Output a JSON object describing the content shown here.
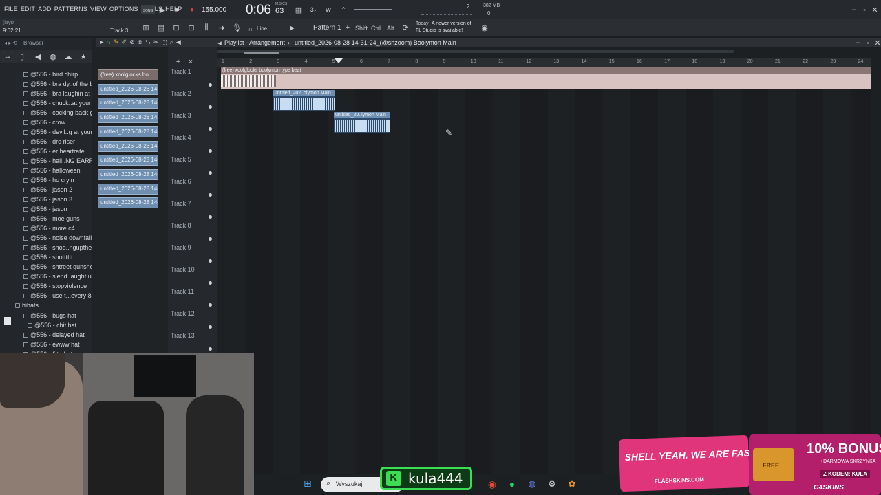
{
  "menu": [
    "FILE",
    "EDIT",
    "ADD",
    "PATTERNS",
    "VIEW",
    "OPTIONS",
    "TOOLS",
    "HELP"
  ],
  "transport": {
    "mode": "SONG",
    "bpm": "155.000",
    "time_main": "0:06",
    "time_sub": "63",
    "time_unit": "M:S:CS",
    "pattern": "Pattern 1",
    "line_mode": "Line",
    "num_a": "2",
    "num_b": "0"
  },
  "memory": "382 MB",
  "user": {
    "name": "(kryst",
    "time": "9:02:21"
  },
  "hint_label": "Track 3",
  "modifiers": [
    "Shift",
    "Ctrl",
    "Alt"
  ],
  "news": {
    "today": "Today",
    "line1": "A newer version of",
    "line2": "FL Studio is available!"
  },
  "browser": {
    "title": "Browser",
    "items": [
      "@556 - bird chirp",
      "@556 - bra dy..of the beat",
      "@556 - bra laughin at u",
      "@556 - chuck..at your cut",
      "@556 - cocking back gun",
      "@556 - crow",
      "@556 - devil..g at your cut",
      "@556 - dro riser",
      "@556 - er heartrate",
      "@556 - hall..NG EARRAPE)",
      "@556 - halloween",
      "@556 - ho cryin",
      "@556 - jason 2",
      "@556 - jason 3",
      "@556 - jason",
      "@556 - moe guns",
      "@556 - more c4",
      "@556 - noise downfall",
      "@556 - shoo..nguptheclub",
      "@556 - shotttttt",
      "@556 - shtreet gunshot",
      "@556 - slend..aught u bro",
      "@556 - stopviolence",
      "@556 - use t...every 8 bars"
    ],
    "folder": "hihats",
    "sub_items": [
      "@556 - bugs hat",
      "@556 - chit hat",
      "@556 - delayed hat",
      "@556 - ewww hat",
      "@556 - filta hat"
    ]
  },
  "clip_picker": [
    "(free) xoolglocks bo...",
    "untitled_2026-08-28 14-...",
    "untitled_2026-08-28 14-...",
    "untitled_2026-08-28 14-...",
    "untitled_2026-08-28 14-...",
    "untitled_2026-08-28 14-...",
    "untitled_2026-08-28 14-...",
    "untitled_2026-08-28 14-...",
    "untitled_2026-08-28 14-...",
    "untitled_2026-08-28 14-..."
  ],
  "playlist": {
    "title": "Playlist - Arrangement",
    "path": "untitled_2026-08-28 14-31-24_(@shzoom) Boolymon Main",
    "tracks": [
      "Track 1",
      "Track 2",
      "Track 3",
      "Track 4",
      "Track 5",
      "Track 6",
      "Track 7",
      "Track 8",
      "Track 9",
      "Track 10",
      "Track 11",
      "Track 12",
      "Track 13"
    ],
    "ruler": [
      "1",
      "2",
      "3",
      "4",
      "5",
      "6",
      "7",
      "8",
      "9",
      "10",
      "11",
      "12",
      "13",
      "14",
      "15",
      "16",
      "17",
      "18",
      "19",
      "20",
      "21",
      "22",
      "23",
      "24"
    ],
    "clips": [
      {
        "label": "(free) xoolglocks boolymon type beat"
      },
      {
        "label": "untitled_202..olymon Main"
      },
      {
        "label": "untitled_20..lymon Main"
      }
    ]
  },
  "taskbar": {
    "search": "Wyszukaj"
  },
  "overlay": {
    "streamer": "kula444",
    "ad_left": "SHELL YEAH. WE ARE FAST!",
    "ad_left_site": "FLASHSKINS.COM",
    "ad_right_title": "10% BONUS",
    "ad_right_sub": "+DARMOWA SKRZYNKA",
    "ad_right_code": "Z KODEM: KULA",
    "ad_right_brand": "G4SKINS",
    "ad_chest": "FREE"
  }
}
